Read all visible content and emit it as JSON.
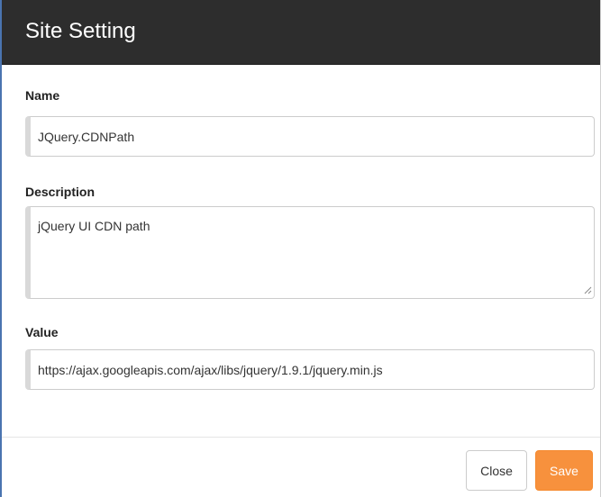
{
  "dialog": {
    "title": "Site Setting"
  },
  "form": {
    "name": {
      "label": "Name",
      "value": "JQuery.CDNPath"
    },
    "description": {
      "label": "Description",
      "value": "jQuery UI CDN path"
    },
    "value": {
      "label": "Value",
      "value": "https://ajax.googleapis.com/ajax/libs/jquery/1.9.1/jquery.min.js"
    }
  },
  "footer": {
    "close_label": "Close",
    "save_label": "Save"
  },
  "colors": {
    "header_bg": "#2d2d2d",
    "save_button": "#f7913d",
    "title_text": "#ffffff"
  }
}
